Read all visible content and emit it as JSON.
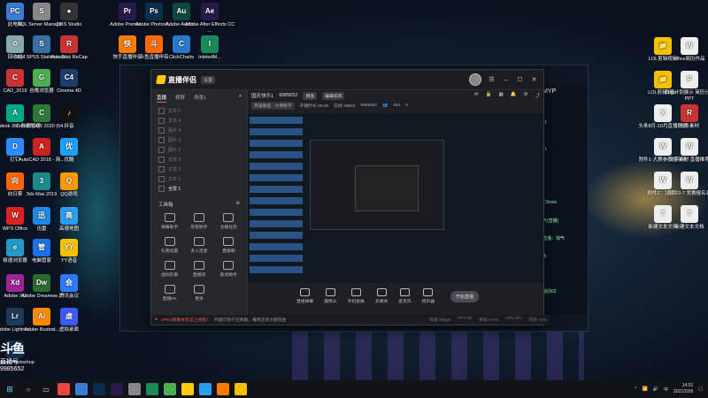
{
  "desktop": {
    "icons_left": [
      {
        "label": "此电脑",
        "color": "#3a7bd5",
        "glyph": "PC"
      },
      {
        "label": "回收站",
        "color": "#8aa",
        "glyph": "♻"
      },
      {
        "label": "CAD_2019",
        "color": "#c33",
        "glyph": "C"
      },
      {
        "label": "Autodesk 360\n数据管理",
        "color": "#0a8",
        "glyph": "A"
      },
      {
        "label": "钉钉",
        "color": "#2a8cff",
        "glyph": "D"
      },
      {
        "label": "向日葵",
        "color": "#f60",
        "glyph": "向"
      },
      {
        "label": "WPS Office",
        "color": "#d22",
        "glyph": "W"
      },
      {
        "label": "极速浏览器",
        "color": "#29c",
        "glyph": "e"
      },
      {
        "label": "Adobe XD",
        "color": "#a0239a",
        "glyph": "Xd"
      },
      {
        "label": "Adobe Lightroo...",
        "color": "#1e3a5a",
        "glyph": "Lr"
      },
      {
        "label": "Adobe Photoshop",
        "color": "#0c2d4e",
        "glyph": "Ps"
      }
    ],
    "icons_col2": [
      {
        "label": "SQL Server Manage...",
        "color": "#888",
        "glyph": "S"
      },
      {
        "label": "IBM SPSS Statistics 21",
        "color": "#3a6ea5",
        "glyph": "S"
      },
      {
        "label": "谷歌浏览器",
        "color": "#4caf50",
        "glyph": "G"
      },
      {
        "label": "CorelDRAW 2020 (64...",
        "color": "#2c7a3a",
        "glyph": "C"
      },
      {
        "label": "AutoCAD 2018 - 简...",
        "color": "#c22",
        "glyph": "A"
      },
      {
        "label": "3ds Max 2019",
        "color": "#1b8a8a",
        "glyph": "3"
      },
      {
        "label": "迅雷",
        "color": "#1e88e5",
        "glyph": "迅"
      },
      {
        "label": "电脑管家",
        "color": "#1a73e8",
        "glyph": "管"
      },
      {
        "label": "Adobe Dreamwe...",
        "color": "#2d6a2d",
        "glyph": "Dw"
      },
      {
        "label": "Adobe Illustrat...",
        "color": "#ff8a00",
        "glyph": "Ai"
      }
    ],
    "icons_col3": [
      {
        "label": "OBS Studio",
        "color": "#333",
        "glyph": "●"
      },
      {
        "label": "Autodesk ReCap",
        "color": "#c33",
        "glyph": "R"
      },
      {
        "label": "Cinema 4D",
        "color": "#1d3d6d",
        "glyph": "C4"
      },
      {
        "label": "抖音",
        "color": "#111",
        "glyph": "♪"
      },
      {
        "label": "优酷",
        "color": "#1ea0ff",
        "glyph": "优"
      },
      {
        "label": "QQ游戏",
        "color": "#f90",
        "glyph": "Q"
      },
      {
        "label": "高德地图",
        "color": "#2a9df4",
        "glyph": "高"
      },
      {
        "label": "YY语音",
        "color": "#f5c400",
        "glyph": "YY"
      },
      {
        "label": "腾讯会议",
        "color": "#2b7bff",
        "glyph": "会"
      },
      {
        "label": "虚拟桌面",
        "color": "#3d5afe",
        "glyph": "虚"
      }
    ],
    "icons_top": [
      {
        "label": "Adobe Premie...",
        "color": "#2a1a4a",
        "glyph": "Pr"
      },
      {
        "label": "Adobe Photosh...",
        "color": "#0c2d4e",
        "glyph": "Ps"
      },
      {
        "label": "Adobe Auditi...",
        "color": "#0a4a3a",
        "glyph": "Au"
      },
      {
        "label": "Adobe After Effects CC ...",
        "color": "#2a1a4a",
        "glyph": "Ae"
      },
      {
        "label": "快手直播伴侣",
        "color": "#ff7a00",
        "glyph": "快"
      },
      {
        "label": "斗鱼直播伴侣",
        "color": "#ff6a00",
        "glyph": "斗"
      },
      {
        "label": "ClickCharts",
        "color": "#2a7acc",
        "glyph": "C"
      },
      {
        "label": "InletedM...",
        "color": "#1a8a5a",
        "glyph": "I"
      }
    ],
    "icons_right": [
      {
        "label": "LOL剪辑视频",
        "color": "#f2c200",
        "glyph": "📁"
      },
      {
        "label": "office简历作品",
        "color": "#eee",
        "glyph": "W"
      },
      {
        "label": "LOL剪辑 bgm",
        "color": "#f2c200",
        "glyph": "📁"
      },
      {
        "label": "旗舰计划展示 简历分析PPT",
        "color": "#eee",
        "glyph": "P"
      },
      {
        "label": "头条8月-10月直播数据",
        "color": "#eee",
        "glyph": "X"
      },
      {
        "label": "头条素材",
        "color": "#c33",
        "glyph": "R"
      },
      {
        "label": "附件1-大赛参赛报名表",
        "color": "#eee",
        "glyph": "W"
      },
      {
        "label": "文字素材 直播推荐",
        "color": "#eee",
        "glyph": "W"
      },
      {
        "label": "附件2：北京...",
        "color": "#eee",
        "glyph": "W"
      },
      {
        "label": "附件3-7 竞赛报名表",
        "color": "#eee",
        "glyph": "W"
      },
      {
        "label": "新建文本文档",
        "color": "#eee",
        "glyph": "T"
      },
      {
        "label": "新建文本文档",
        "color": "#eee",
        "glyph": "T"
      }
    ]
  },
  "app": {
    "logo": "直播伴侣",
    "version": "设置",
    "scene_tabs": [
      "直播",
      "横屏",
      "场景1"
    ],
    "sources": [
      "文本 5",
      "文本 4",
      "图片 4",
      "图片 3",
      "图片 2",
      "文本 3",
      "文本 2",
      "文本 1",
      "全屏 1"
    ],
    "tools_title": "工具箱",
    "tools": [
      "弹幕助手",
      "房管助手",
      "主播任务",
      "礼物设置",
      "多人连麦",
      "直播聊",
      "虚拟形象",
      "直播间",
      "歌词助手",
      "直播PK",
      "更多"
    ],
    "room_name": "国庆快乐1",
    "room_id": "9985652",
    "room_tag": "频道",
    "room_btn": "编辑房间",
    "room2": [
      "英雄联盟 - 大神教学",
      "开播时长 00:00",
      "在线 49802",
      "9985652",
      "454",
      "0"
    ],
    "controls": [
      "直播弹幕",
      "摄像头",
      "手机投屏",
      "多媒体",
      "麦克风",
      "扬声器"
    ],
    "go_live": "开始直播",
    "status_warn": "APEX新版本玩法上线啦！",
    "status_text": "开播可领千元奖励，每周还有大额现金",
    "stats": [
      "码率 0kbps",
      "FPS 30",
      "丢帧 0.0%",
      "CPU 5%",
      "内存 42%"
    ]
  },
  "bgwin": {
    "user": "MYP",
    "side_texts": [
      "1",
      "1",
      "T3ksss",
      "气(直播)",
      "直播：淘气",
      "太",
      "播前02"
    ]
  },
  "watermark": {
    "big": "斗鱼",
    "sub": "直播号",
    "id": "9985652"
  },
  "taskbar": {
    "time": "14:51",
    "date": "2021/10/6",
    "apps": [
      "#e44",
      "#3a7bd5",
      "#0c2d4e",
      "#2a1a4a",
      "#888",
      "#1a8a5a",
      "#4caf50",
      "#ffcc00",
      "#2a9df4",
      "#ff7a00",
      "#f2c200"
    ]
  }
}
